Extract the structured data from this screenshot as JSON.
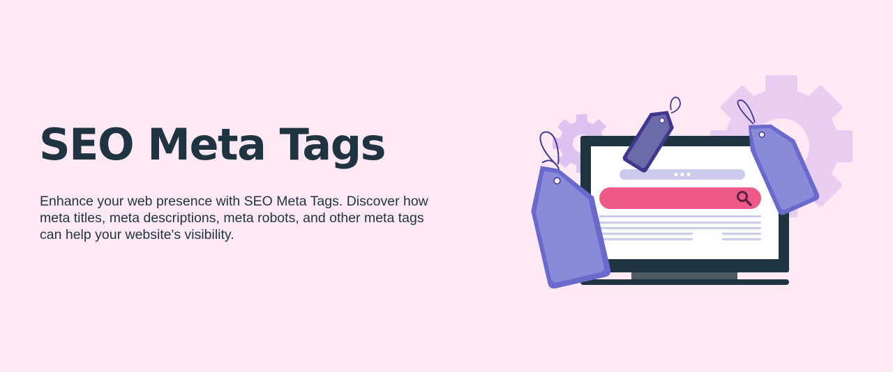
{
  "hero": {
    "title": "SEO Meta Tags",
    "description_lines": [
      "Enhance your web presence with SEO Meta Tags. Discover how",
      "meta titles, meta descriptions, meta robots, and other meta tags",
      "can help your website's visibility."
    ]
  },
  "illustration": {
    "icons": [
      "gear-icon",
      "price-tag-icon",
      "monitor-icon",
      "search-icon"
    ],
    "colors": {
      "background": "#fde9f4",
      "gear": "#e8cdf0",
      "gear_small": "#dcc2ee",
      "tag_light": "#8a8ad9",
      "tag_border": "#6a69cc",
      "tag_dark": "#6c6aa8",
      "tag_dark_border": "#40388f",
      "monitor_frame": "#1f3440",
      "monitor_stand": "#4e5b5f",
      "screen": "#ffffff",
      "search_bar": "#ee5a87",
      "search_icon": "#5a1f3f",
      "address_bar": "#c9caec",
      "text_lines": "#c9caec"
    }
  }
}
